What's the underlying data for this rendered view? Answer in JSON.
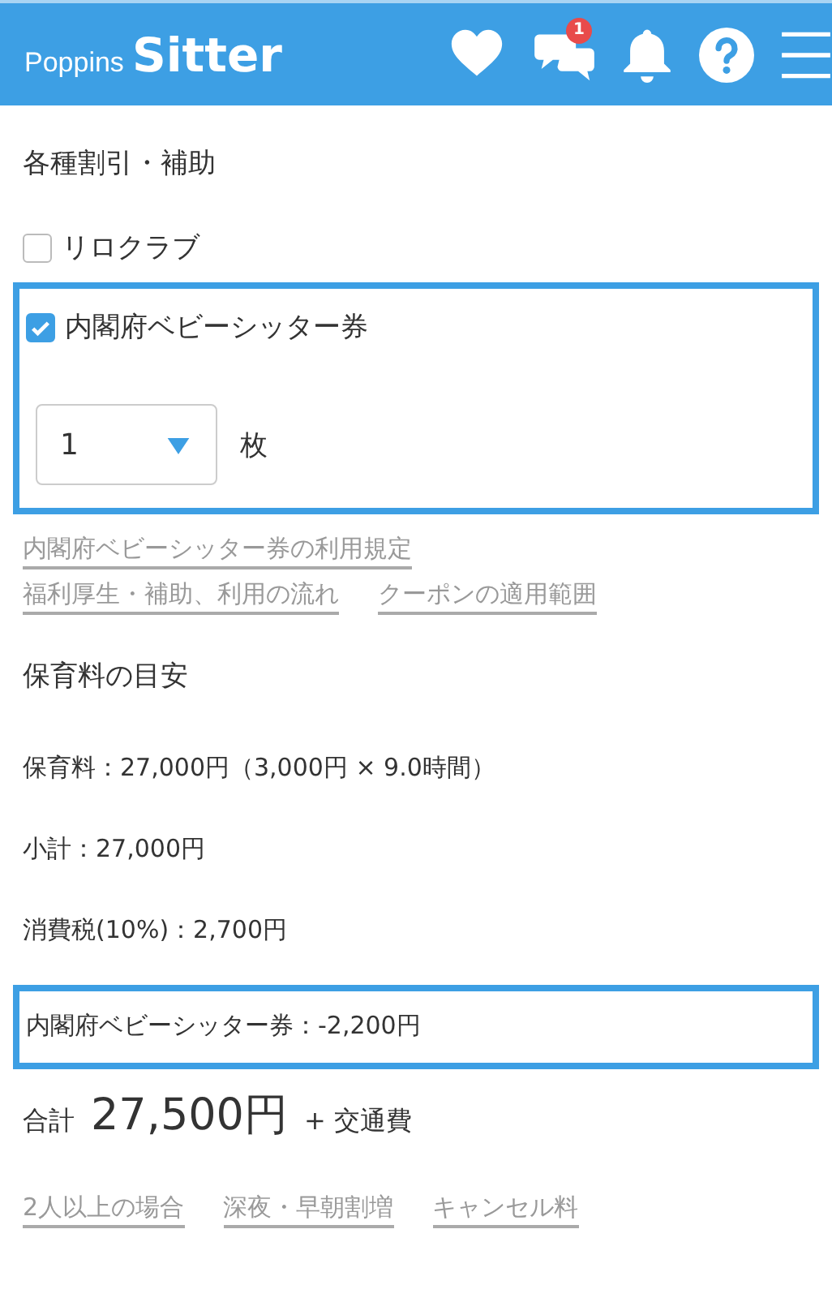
{
  "header": {
    "logo_small": "Poppins",
    "logo_big": "Sitter",
    "icons": [
      {
        "kind": "heart"
      },
      {
        "kind": "chat",
        "badge": "1"
      },
      {
        "kind": "bell"
      },
      {
        "kind": "help"
      },
      {
        "kind": "menu"
      }
    ]
  },
  "discounts": {
    "title": "各種割引・補助",
    "options": [
      {
        "label": "リロクラブ",
        "checked": false
      },
      {
        "label": "内閣府ベビーシッター券",
        "checked": true,
        "quantity": {
          "value": "1",
          "unit": "枚"
        }
      }
    ],
    "link_rows": [
      [
        "内閣府ベビーシッター券の利用規定"
      ],
      [
        "福利厚生・補助、利用の流れ",
        "クーポンの適用範囲"
      ]
    ]
  },
  "estimate": {
    "title": "保育料の目安",
    "lines": [
      {
        "text": "保育料：27,000円（3,000円 × 9.0時間）",
        "highlighted": false
      },
      {
        "text": "小計：27,000円",
        "highlighted": false
      },
      {
        "text": "消費税(10%)：2,700円",
        "highlighted": false
      },
      {
        "text": "内閣府ベビーシッター券：-2,200円",
        "highlighted": true
      }
    ],
    "total": {
      "label": "合計",
      "amount": "27,500円",
      "suffix": "+ 交通費"
    }
  },
  "bottom_links": [
    "2人以上の場合",
    "深夜・早朝割増",
    "キャンセル料"
  ]
}
